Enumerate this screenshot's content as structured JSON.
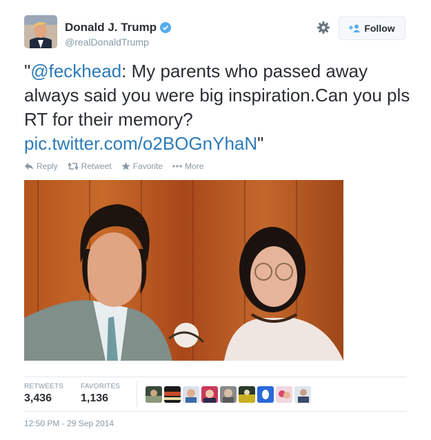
{
  "author": {
    "name": "Donald J. Trump",
    "handle": "@realDonaldTrump",
    "verified": true
  },
  "header": {
    "follow_label": "Follow",
    "settings_icon": "gear-icon"
  },
  "tweet": {
    "quote_open": "\"",
    "mention": "@feckhead",
    "body": ":  My parents who passed away always said you were big inspiration.Can you pls RT for their memory? ",
    "link": "pic.twitter.com/o2BOGnYhaN",
    "quote_close": "\""
  },
  "actions": [
    {
      "label": "Reply",
      "icon": "reply-icon"
    },
    {
      "label": "Retweet",
      "icon": "retweet-icon"
    },
    {
      "label": "Favorite",
      "icon": "star-icon"
    },
    {
      "label": "More",
      "icon": "more-icon"
    }
  ],
  "stats": {
    "retweets_label": "RETWEETS",
    "retweets_count": "3,436",
    "favorites_label": "FAVORITES",
    "favorites_count": "1,136"
  },
  "timestamp": "12:50 PM - 29 Sep 2014",
  "colors": {
    "link": "#2b7bb9",
    "verified": "#55acee",
    "muted": "#8899a6",
    "text": "#292f33"
  }
}
